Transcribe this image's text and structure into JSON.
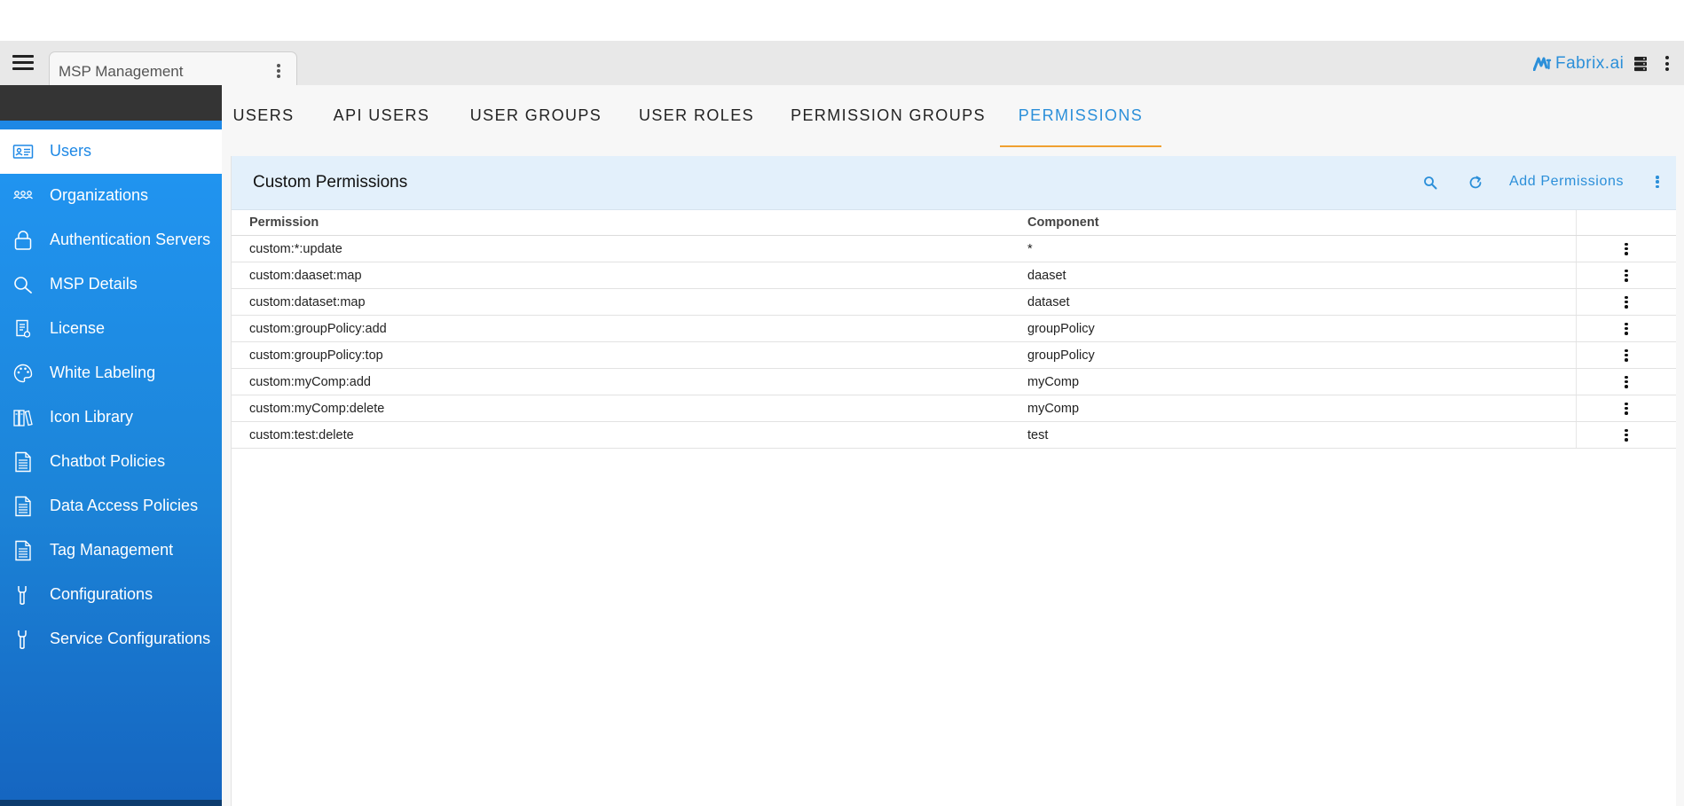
{
  "app": {
    "tab_title": "MSP Management",
    "brand_name": "Fabrix.ai",
    "brand_color": "#2b8fd9"
  },
  "sidebar": {
    "accent_color": "#2196f3",
    "items": [
      {
        "label": "Users",
        "icon": "user-card-icon",
        "active": true
      },
      {
        "label": "Organizations",
        "icon": "people-group-icon"
      },
      {
        "label": "Authentication Servers",
        "icon": "lock-icon"
      },
      {
        "label": "MSP Details",
        "icon": "search-icon"
      },
      {
        "label": "License",
        "icon": "license-document-icon"
      },
      {
        "label": "White Labeling",
        "icon": "palette-icon"
      },
      {
        "label": "Icon Library",
        "icon": "library-books-icon"
      },
      {
        "label": "Chatbot Policies",
        "icon": "document-icon"
      },
      {
        "label": "Data Access Policies",
        "icon": "document-icon"
      },
      {
        "label": "Tag Management",
        "icon": "document-icon"
      },
      {
        "label": "Configurations",
        "icon": "wrench-icon"
      },
      {
        "label": "Service Configurations",
        "icon": "wrench-icon"
      }
    ]
  },
  "tabs": [
    {
      "label": "USERS"
    },
    {
      "label": "API USERS"
    },
    {
      "label": "USER GROUPS"
    },
    {
      "label": "USER ROLES"
    },
    {
      "label": "PERMISSION GROUPS"
    },
    {
      "label": "PERMISSIONS",
      "active": true
    }
  ],
  "panel": {
    "title": "Custom Permissions",
    "add_label": "Add Permissions",
    "columns": [
      "Permission",
      "Component"
    ],
    "rows": [
      {
        "permission": "custom:*:update",
        "component": "*"
      },
      {
        "permission": "custom:daaset:map",
        "component": "daaset"
      },
      {
        "permission": "custom:dataset:map",
        "component": "dataset"
      },
      {
        "permission": "custom:groupPolicy:add",
        "component": "groupPolicy"
      },
      {
        "permission": "custom:groupPolicy:top",
        "component": "groupPolicy"
      },
      {
        "permission": "custom:myComp:add",
        "component": "myComp"
      },
      {
        "permission": "custom:myComp:delete",
        "component": "myComp"
      },
      {
        "permission": "custom:test:delete",
        "component": "test"
      }
    ]
  }
}
